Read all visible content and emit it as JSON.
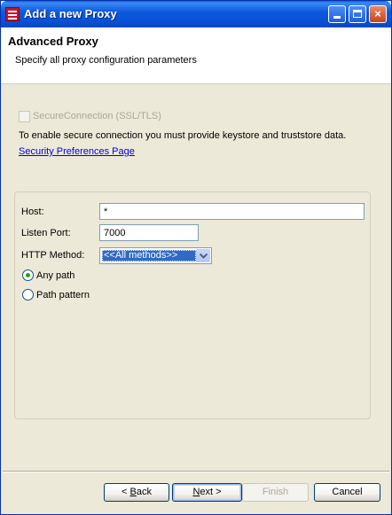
{
  "window": {
    "title": "Add a new Proxy",
    "controls": {
      "minimize": "minimize",
      "maximize": "maximize",
      "close": "×"
    }
  },
  "header": {
    "title": "Advanced Proxy",
    "description": "Specify all proxy configuration parameters"
  },
  "secure": {
    "checkbox_label": "SecureConnection (SSL/TLS)",
    "checked": false,
    "enabled": false,
    "info": "To enable secure connection you must provide keystore and truststore data.",
    "link": "Security Preferences Page"
  },
  "form": {
    "host_label": "Host:",
    "host_value": "*",
    "port_label": "Listen Port:",
    "port_value": "7000",
    "method_label": "HTTP Method:",
    "method_value": "<<All methods>>",
    "any_path_label": "Any path",
    "path_pattern_label": "Path pattern",
    "selected_path_option": "Any path"
  },
  "footer": {
    "back_mnemonic": "B",
    "back_rest": "ack",
    "back_prefix": "< ",
    "next_mnemonic": "N",
    "next_rest": "ext >",
    "finish_label": "Finish",
    "cancel_label": "Cancel"
  },
  "colors": {
    "titlebar": "#0653d8",
    "dialog_bg": "#ece9d8",
    "link": "#0000ee",
    "selection": "#316ac5",
    "radio_dot": "#21a121"
  }
}
